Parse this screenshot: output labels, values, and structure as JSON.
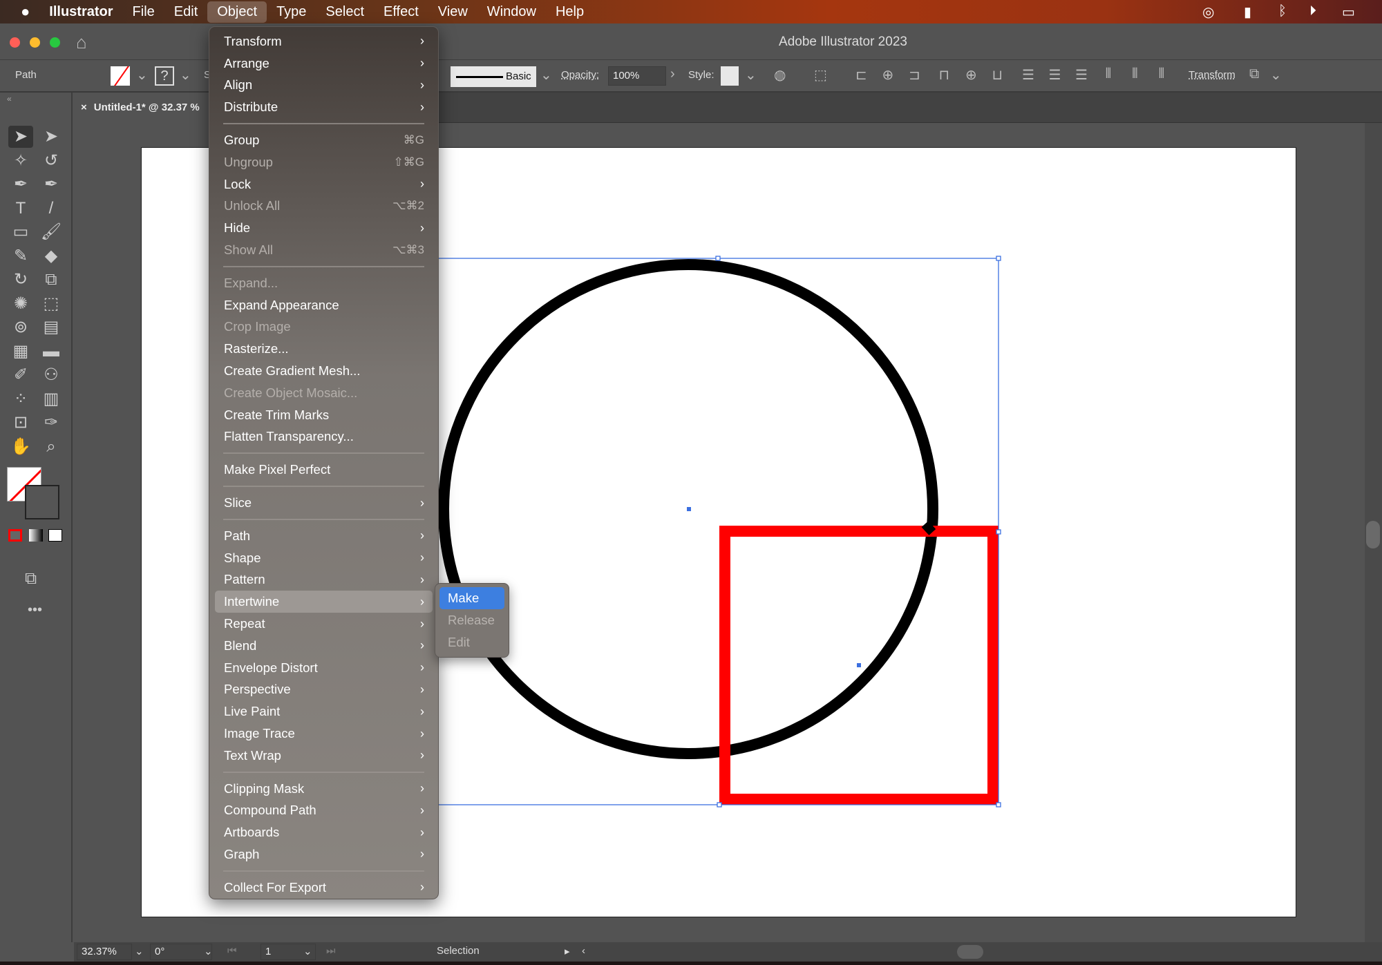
{
  "menubar": {
    "app": "Illustrator",
    "items": [
      "File",
      "Edit",
      "Object",
      "Type",
      "Select",
      "Effect",
      "View",
      "Window",
      "Help"
    ],
    "active": "Object",
    "tray_icons": [
      "creative-cloud-icon",
      "id-badge-icon",
      "bluetooth-icon",
      "play-circle-icon",
      "battery-icon"
    ]
  },
  "window": {
    "title": "Adobe Illustrator 2023"
  },
  "controlbar": {
    "selection_type": "Path",
    "stroke_profile": "Basic",
    "opacity_label": "Opacity:",
    "opacity_value": "100%",
    "style_label": "Style:",
    "transform_label": "Transform",
    "stroke_partial": "S"
  },
  "document_tab": {
    "title": "Untitled-1* @ 32.37 %",
    "close": "×"
  },
  "statusbar": {
    "zoom": "32.37%",
    "rotation": "0°",
    "artboard": "1",
    "tool": "Selection"
  },
  "colors": {
    "accent": "#3d7fe0",
    "selection": "#3b6fe0",
    "circle_stroke": "#000000",
    "square_stroke": "#ff0000"
  },
  "object_menu": {
    "items": [
      {
        "label": "Transform",
        "sub": true
      },
      {
        "label": "Arrange",
        "sub": true
      },
      {
        "label": "Align",
        "sub": true
      },
      {
        "label": "Distribute",
        "sub": true
      },
      {
        "sep": true
      },
      {
        "label": "Group",
        "shortcut": "⌘G"
      },
      {
        "label": "Ungroup",
        "shortcut": "⇧⌘G",
        "disabled": true
      },
      {
        "label": "Lock",
        "sub": true
      },
      {
        "label": "Unlock All",
        "shortcut": "⌥⌘2",
        "disabled": true
      },
      {
        "label": "Hide",
        "sub": true
      },
      {
        "label": "Show All",
        "shortcut": "⌥⌘3",
        "disabled": true
      },
      {
        "sep": true
      },
      {
        "label": "Expand...",
        "disabled": true
      },
      {
        "label": "Expand Appearance"
      },
      {
        "label": "Crop Image",
        "disabled": true
      },
      {
        "label": "Rasterize..."
      },
      {
        "label": "Create Gradient Mesh..."
      },
      {
        "label": "Create Object Mosaic...",
        "disabled": true
      },
      {
        "label": "Create Trim Marks"
      },
      {
        "label": "Flatten Transparency..."
      },
      {
        "sep": true
      },
      {
        "label": "Make Pixel Perfect"
      },
      {
        "sep": true
      },
      {
        "label": "Slice",
        "sub": true
      },
      {
        "sep": true
      },
      {
        "label": "Path",
        "sub": true
      },
      {
        "label": "Shape",
        "sub": true
      },
      {
        "label": "Pattern",
        "sub": true
      },
      {
        "label": "Intertwine",
        "sub": true,
        "highlighted": true
      },
      {
        "label": "Repeat",
        "sub": true
      },
      {
        "label": "Blend",
        "sub": true
      },
      {
        "label": "Envelope Distort",
        "sub": true
      },
      {
        "label": "Perspective",
        "sub": true
      },
      {
        "label": "Live Paint",
        "sub": true
      },
      {
        "label": "Image Trace",
        "sub": true
      },
      {
        "label": "Text Wrap",
        "sub": true
      },
      {
        "sep": true
      },
      {
        "label": "Clipping Mask",
        "sub": true
      },
      {
        "label": "Compound Path",
        "sub": true
      },
      {
        "label": "Artboards",
        "sub": true
      },
      {
        "label": "Graph",
        "sub": true
      },
      {
        "sep": true
      },
      {
        "label": "Collect For Export",
        "sub": true
      }
    ]
  },
  "intertwine_submenu": {
    "items": [
      {
        "label": "Make",
        "highlighted": true
      },
      {
        "label": "Release",
        "disabled": true
      },
      {
        "label": "Edit",
        "disabled": true
      }
    ]
  }
}
